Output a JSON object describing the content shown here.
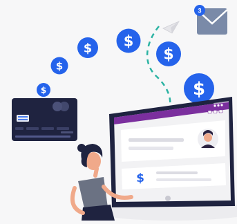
{
  "mail": {
    "badge_count": "3",
    "icon": "envelope-icon"
  },
  "coins": {
    "symbol": "$",
    "color": "#2563eb",
    "count": 7
  },
  "card": {
    "color": "#1f2340",
    "accent": "#7c86c9"
  },
  "monitor": {
    "browser_bar_color": "#7b2f9e",
    "screen_bg": "#f2f2f4",
    "dollar_symbol": "$"
  },
  "colors": {
    "background": "#f7f7f8",
    "coin_blue": "#2563eb",
    "dash_teal": "#2bb3a3"
  }
}
